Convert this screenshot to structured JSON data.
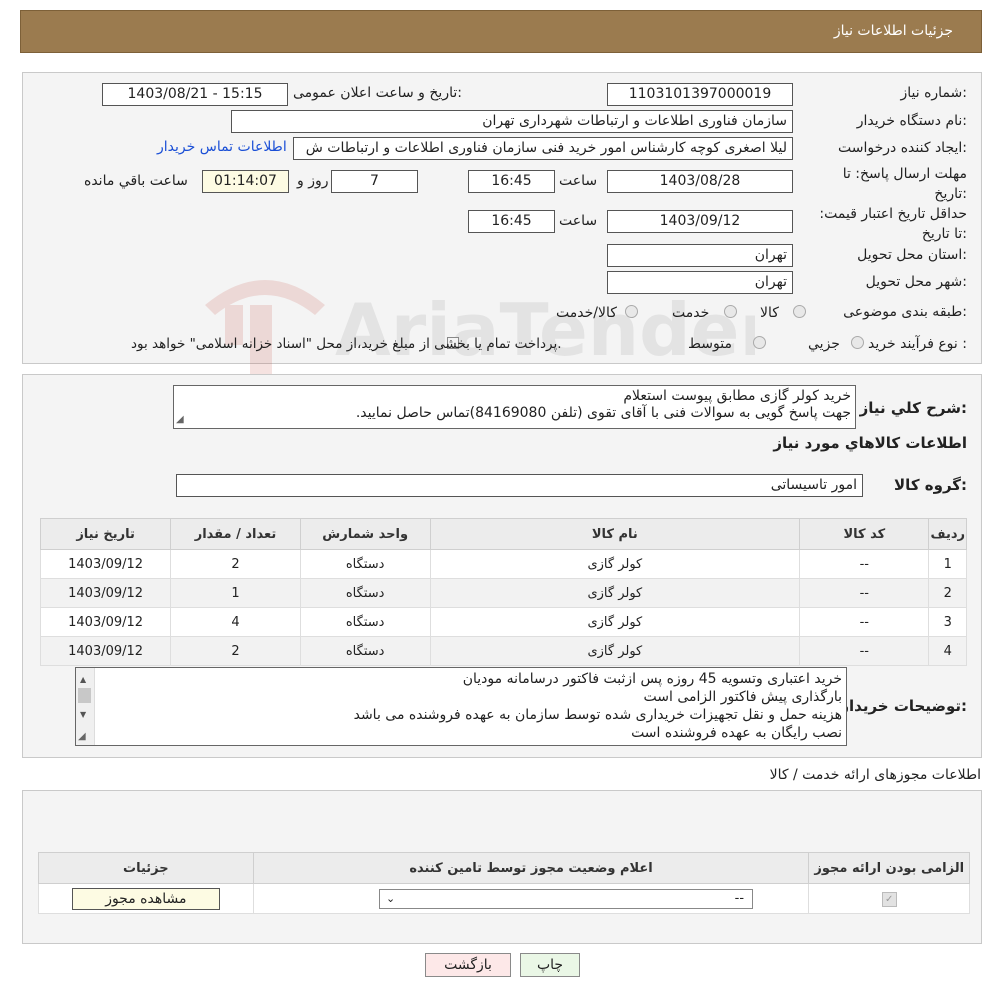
{
  "header": {
    "title": "جزئیات اطلاعات نیاز"
  },
  "labels": {
    "need_number": "شماره نیاز:",
    "announce_datetime": "تاریخ و ساعت اعلان عمومی:",
    "buyer_org": "نام دستگاه خریدار:",
    "requester": "ایجاد کننده درخواست:",
    "deadline": "مهلت ارسال پاسخ: تا تاریخ:",
    "validity": "حداقل تاریخ اعتبار قیمت: تا تاریخ:",
    "time": "ساعت",
    "days_and": "روز و",
    "remaining": "ساعت باقي مانده",
    "province": "استان محل تحویل:",
    "city": "شهر محل تحویل:",
    "category": "طبقه بندی موضوعی:",
    "process_type": "نوع فرآیند خرید :",
    "general_desc": "شرح کلي نياز:",
    "items_info": "اطلاعات کالاهاي مورد نياز",
    "goods_group": "گروه کالا:",
    "buyer_notes": "توضیحات خریدار:",
    "permits_title": "اطلاعات مجوزهای ارائه خدمت / کالا"
  },
  "fields": {
    "need_number": "1103101397000019",
    "announce_datetime": "1403/08/21 - 15:15",
    "buyer_org": "سازمان فناوری اطلاعات و ارتباطات شهرداری تهران",
    "requester": "لیلا اصغری کوچه کارشناس امور خرید فنی سازمان فناوری اطلاعات و ارتباطات ش",
    "buyer_contact_link": "اطلاعات تماس خریدار",
    "deadline_date": "1403/08/28",
    "deadline_time": "16:45",
    "days": "7",
    "remaining_time": "01:14:07",
    "validity_date": "1403/09/12",
    "validity_time": "16:45",
    "province": "تهران",
    "city": "تهران",
    "goods_group": "امور تاسیساتی"
  },
  "category_options": [
    "کالا",
    "خدمت",
    "کالا/خدمت"
  ],
  "process_options": [
    "جزيي",
    "متوسط"
  ],
  "process_note": "پرداخت تمام یا بخشی از مبلغ خرید،از محل \"اسناد خزانه اسلامی\" خواهد بود.",
  "general_desc_lines": [
    "خرید کولر گازی مطابق پیوست استعلام",
    "جهت پاسخ گویی به سوالات فنی با آقای تقوی (تلفن 84169080)تماس حاصل نمایید."
  ],
  "items_table": {
    "headers": [
      "رديف",
      "کد کالا",
      "نام کالا",
      "واحد شمارش",
      "تعداد / مقدار",
      "تاریخ نیاز"
    ],
    "rows": [
      [
        "1",
        "--",
        "کولر گازی",
        "دستگاه",
        "2",
        "1403/09/12"
      ],
      [
        "2",
        "--",
        "کولر گازی",
        "دستگاه",
        "1",
        "1403/09/12"
      ],
      [
        "3",
        "--",
        "کولر گازی",
        "دستگاه",
        "4",
        "1403/09/12"
      ],
      [
        "4",
        "--",
        "کولر گازی",
        "دستگاه",
        "2",
        "1403/09/12"
      ]
    ]
  },
  "buyer_notes_lines": [
    "خرید اعتباری وتسویه 45 روزه پس ازثبت فاکتور درسامانه مودیان",
    "بارگذاری پیش فاکتور الزامی است",
    "هزینه حمل و نقل تجهیزات خریداری شده توسط سازمان به عهده فروشنده می باشد",
    "نصب رایگان به عهده فروشنده است"
  ],
  "permits_table": {
    "headers": [
      "الزامی بودن ارائه مجوز",
      "اعلام وضعیت مجوز توسط تامین کننده",
      "جزئیات"
    ],
    "select_value": "--",
    "view_button": "مشاهده مجوز"
  },
  "buttons": {
    "print": "چاپ",
    "back": "بازگشت"
  },
  "watermark": {
    "text": "AriaTender.neT"
  },
  "colors": {
    "header_bg": "#9b7b4f",
    "link": "#1a4fd6",
    "back_button_bg": "#fde8e8",
    "print_button_bg": "#eaf7e6"
  }
}
